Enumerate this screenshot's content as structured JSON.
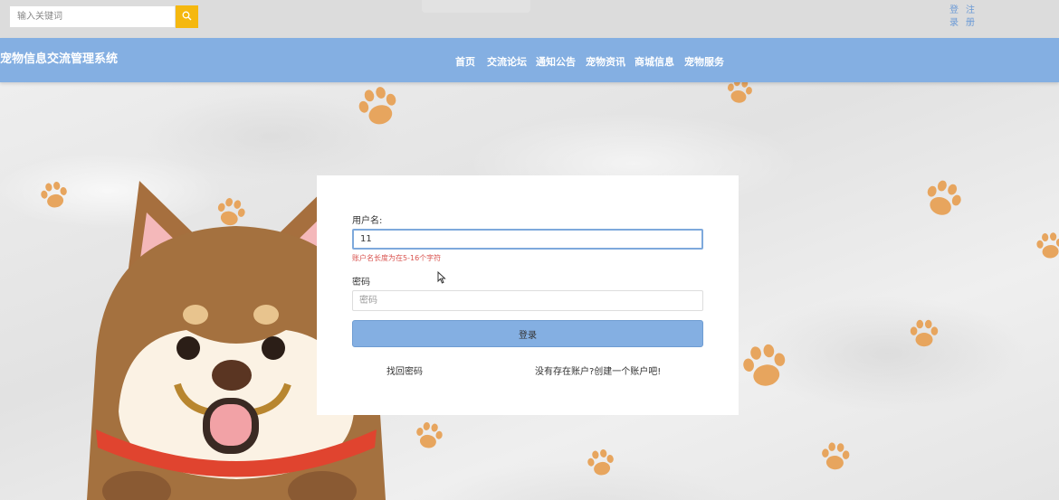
{
  "topbar": {
    "search_placeholder": "输入关键词",
    "search_icon": "search-icon",
    "login_label": "登录",
    "register_label": "注册"
  },
  "nav": {
    "site_title": "宠物信息交流管理系统",
    "items": [
      {
        "label": "首页"
      },
      {
        "label": "交流论坛"
      },
      {
        "label": "通知公告"
      },
      {
        "label": "宠物资讯"
      },
      {
        "label": "商城信息"
      },
      {
        "label": "宠物服务"
      }
    ]
  },
  "login": {
    "username_label": "用户名:",
    "username_value": "11",
    "username_error": "账户名长度为在5-16个字符",
    "password_label": "密码",
    "password_placeholder": "密码",
    "submit_label": "登录",
    "forgot_label": "找回密码",
    "register_prompt": "没有存在账户?创建一个账户吧!"
  },
  "colors": {
    "nav_bg": "#84afe2",
    "search_button": "#f5b80f",
    "error": "#d9534f",
    "paw": "#e7a55e"
  }
}
